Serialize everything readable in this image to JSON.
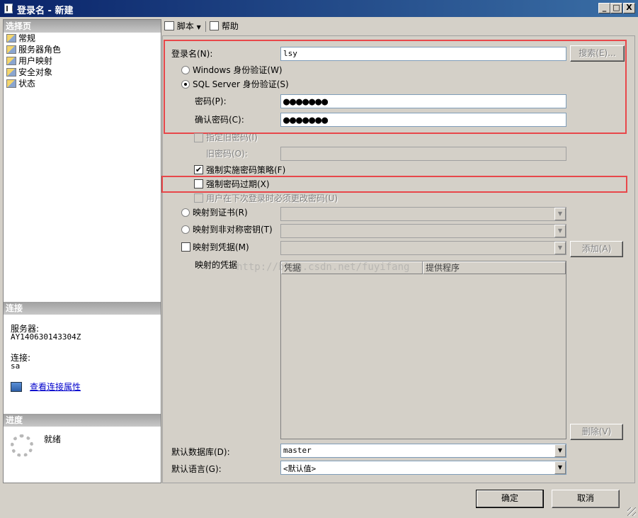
{
  "window": {
    "title": "登录名 - 新建",
    "controls": {
      "minimize": "_",
      "maximize": "□",
      "close": "X"
    }
  },
  "left": {
    "select_page_header": "选择页",
    "pages": [
      {
        "label": "常规",
        "selected": true
      },
      {
        "label": "服务器角色"
      },
      {
        "label": "用户映射"
      },
      {
        "label": "安全对象"
      },
      {
        "label": "状态"
      }
    ],
    "connection_header": "连接",
    "server_label": "服务器:",
    "server_value": "AY140630143304Z",
    "connection_label": "连接:",
    "connection_value": "sa",
    "view_props_link": "查看连接属性",
    "progress_header": "进度",
    "progress_status": "就绪"
  },
  "toolbar": {
    "script_label": "脚本",
    "help_label": "帮助"
  },
  "form": {
    "login_name_label": "登录名(N):",
    "login_name_value": "lsy",
    "search_button": "搜索(E)...",
    "windows_auth_label": "Windows 身份验证(W)",
    "sql_auth_label": "SQL Server 身份验证(S)",
    "password_label": "密码(P):",
    "password_value": "●●●●●●●",
    "confirm_password_label": "确认密码(C):",
    "confirm_password_value": "●●●●●●●",
    "specify_old_password_label": "指定旧密码(I)",
    "old_password_label": "旧密码(O):",
    "enforce_policy_label": "强制实施密码策略(F)",
    "enforce_expiration_label": "强制密码过期(X)",
    "must_change_label": "用户在下次登录时必须更改密码(U)",
    "map_cert_label": "映射到证书(R)",
    "map_asym_key_label": "映射到非对称密钥(T)",
    "map_credential_label": "映射到凭据(M)",
    "add_button": "添加(A)",
    "mapped_credentials_label": "映射的凭据",
    "grid_col_credential": "凭据",
    "grid_col_provider": "提供程序",
    "watermark": "http://blog.csdn.net/fuyifang",
    "remove_button": "删除(V)",
    "default_db_label": "默认数据库(D):",
    "default_db_value": "master",
    "default_lang_label": "默认语言(G):",
    "default_lang_value": "<默认值>"
  },
  "footer": {
    "ok_button": "确定",
    "cancel_button": "取消"
  },
  "colors": {
    "highlight_box": "#e8474a",
    "title_bar": "#0a246a"
  }
}
